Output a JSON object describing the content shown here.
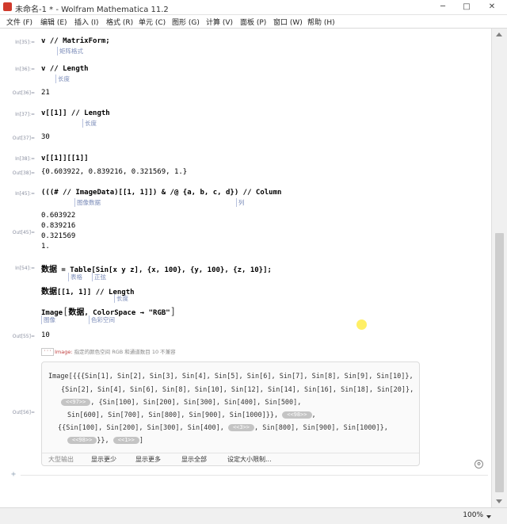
{
  "window": {
    "title": "未命名-1 * - Wolfram Mathematica 11.2",
    "minimize": "─",
    "maximize": "□",
    "close": "✕"
  },
  "menu": [
    "文件 (F)",
    "编辑 (E)",
    "插入 (I)",
    "格式 (R)",
    "单元 (C)",
    "图形 (G)",
    "计算 (V)",
    "面板 (P)",
    "窗口 (W)",
    "帮助 (H)"
  ],
  "cells": {
    "c35": {
      "in_label": "In[35]:=",
      "code": "v // MatrixForm;",
      "hint": "矩阵格式"
    },
    "c36": {
      "in_label": "In[36]:=",
      "code": "v // Length",
      "hint": "长度",
      "out_label": "Out[36]=",
      "output": "21"
    },
    "c37": {
      "in_label": "In[37]:=",
      "code": "v[[1]] // Length",
      "hint": "长度",
      "out_label": "Out[37]=",
      "output": "30"
    },
    "c38": {
      "in_label": "In[38]:=",
      "code": "v[[1]][[1]]",
      "out_label": "Out[38]=",
      "output": "{0.603922, 0.839216, 0.321569, 1.}"
    },
    "c45": {
      "in_label": "In[45]:=",
      "code": "(((# // ImageData)[[1, 1]]) & /@ {a, b, c, d}) // Column",
      "hint1": "图像数据",
      "hint2": "列",
      "out_label": "Out[45]=",
      "outputs": [
        "0.603922",
        "0.839216",
        "0.321569",
        "1."
      ]
    },
    "c54": {
      "in_label": "In[54]:=",
      "line1_pre": "数据",
      "line1_rest": " = Table[Sin[x y z], {x, 100}, {y, 100}, {z, 10}];",
      "hint_table": "表格",
      "hint_sin": "正弦",
      "line2_pre": "数据",
      "line2_rest": "[[1, 1]] // Length",
      "hint_length": "长度",
      "line3_a": "Image",
      "line3_b": "数据",
      "line3_c": ", ColorSpace → \"RGB\"",
      "hint_image": "图像",
      "hint_colorspace": "色彩空间"
    },
    "c55": {
      "out_label": "Out[55]=",
      "output": "10"
    },
    "msg": {
      "tag": "Image",
      "sep": ": ",
      "text": "指定的颜色空间 RGB 和通道数目 10 不兼容"
    },
    "c56": {
      "out_label": "Out[56]=",
      "l1": "Image[{{{Sin[1], Sin[2], Sin[3], Sin[4], Sin[5], Sin[6], Sin[7], Sin[8], Sin[9], Sin[10]},",
      "l2": "{Sin[2], Sin[4], Sin[6], Sin[8], Sin[10], Sin[12], Sin[14], Sin[16], Sin[18], Sin[20]},",
      "l3_skel": "<<97>>",
      "l3_rest": ", {Sin[100], Sin[200], Sin[300], Sin[400], Sin[500],",
      "l4_a": "Sin[600], Sin[700], Sin[800], Sin[900], Sin[1000]}},",
      "l4_skel": "<<98>>",
      "l4_b": ",",
      "l5_a": "{{Sin[100], Sin[200], Sin[300], Sin[400],",
      "l5_skel": "<<3>>",
      "l5_b": ", Sin[800], Sin[900], Sin[1000]},",
      "l6_skel1": "<<98>>",
      "l6_mid": "}},",
      "l6_skel2": "<<1>>",
      "l6_end": "]",
      "buttons": [
        "大型输出",
        "显示更少",
        "显示更多",
        "显示全部",
        "设定大小限制..."
      ]
    }
  },
  "status": {
    "zoom": "100%"
  }
}
